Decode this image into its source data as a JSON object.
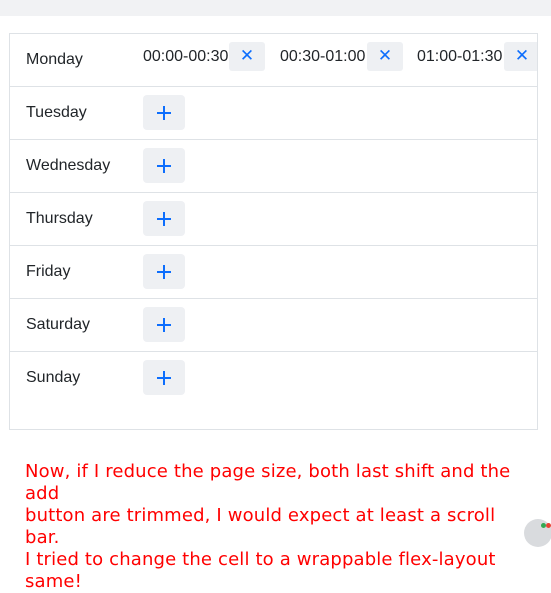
{
  "schedule": {
    "days": [
      {
        "name": "Monday",
        "shifts": [
          "00:00-00:30",
          "00:30-01:00",
          "01:00-01:30"
        ]
      },
      {
        "name": "Tuesday",
        "shifts": []
      },
      {
        "name": "Wednesday",
        "shifts": []
      },
      {
        "name": "Thursday",
        "shifts": []
      },
      {
        "name": "Friday",
        "shifts": []
      },
      {
        "name": "Saturday",
        "shifts": []
      },
      {
        "name": "Sunday",
        "shifts": []
      }
    ],
    "remove_glyph": "✕"
  },
  "note": {
    "lines": [
      "Now, if I reduce the page size, both last shift and the add",
      "button are trimmed, I would expect at least a scroll bar.",
      "I tried to change the cell to a wrappable flex-layout same!"
    ]
  },
  "colors": {
    "accent": "#0d6efd",
    "note_text": "#ff0000",
    "button_bg": "#eef0f3"
  }
}
